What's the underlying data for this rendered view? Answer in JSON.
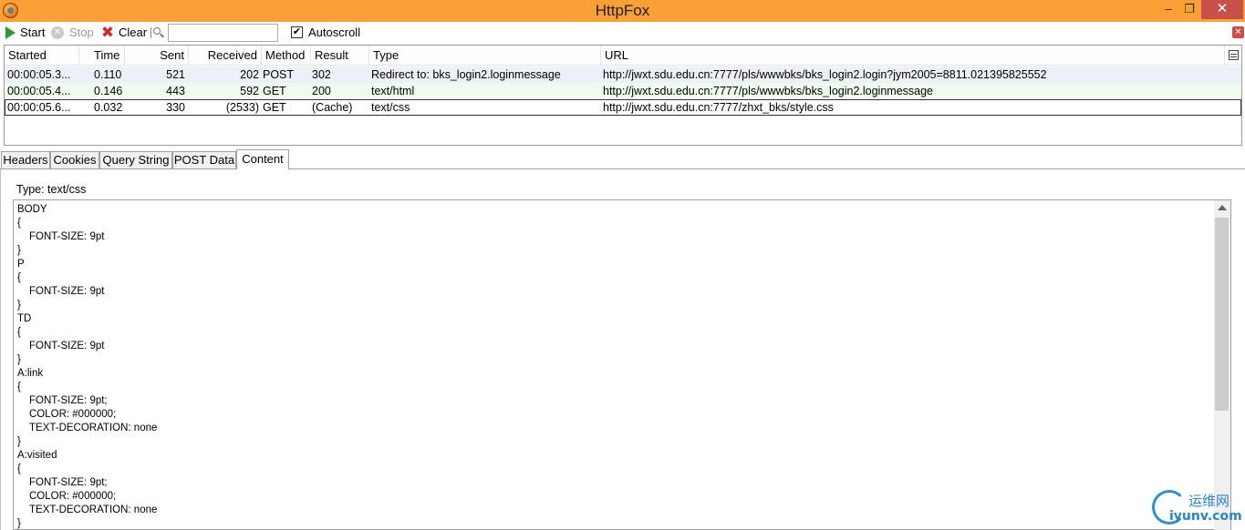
{
  "window": {
    "title": "HttpFox",
    "minimize_glyph": "–",
    "maximize_glyph": "❐",
    "close_glyph": "✕"
  },
  "toolbar": {
    "start_label": "Start",
    "stop_label": "Stop",
    "clear_label": "Clear",
    "search_value": "",
    "autoscroll_label": "Autoscroll",
    "autoscroll_checked": true,
    "icons": [
      "play-icon",
      "stop-icon",
      "clear-x-icon",
      "search-icon",
      "close-panel-icon"
    ]
  },
  "table": {
    "columns": [
      "Started",
      "Time",
      "Sent",
      "Received",
      "Method",
      "Result",
      "Type",
      "URL"
    ],
    "rows": [
      {
        "started": "00:00:05.3...",
        "time": "0.110",
        "sent": "521",
        "received": "202",
        "method": "POST",
        "result": "302",
        "type": "Redirect to: bks_login2.loginmessage",
        "url": "http://jwxt.sdu.edu.cn:7777/pls/wwwbks/bks_login2.login?jym2005=8811.021395825552",
        "bg": "#eef0f9"
      },
      {
        "started": "00:00:05.4...",
        "time": "0.146",
        "sent": "443",
        "received": "592",
        "method": "GET",
        "result": "200",
        "type": "text/html",
        "url": "http://jwxt.sdu.edu.cn:7777/pls/wwwbks/bks_login2.loginmessage",
        "bg": "#eefbee"
      },
      {
        "started": "00:00:05.6...",
        "time": "0.032",
        "sent": "330",
        "received": "(2533)",
        "method": "GET",
        "result": "(Cache)",
        "type": "text/css",
        "url": "http://jwxt.sdu.edu.cn:7777/zhxt_bks/style.css",
        "bg": "#ffffff",
        "selected": true
      }
    ]
  },
  "tabs": [
    {
      "label": "Headers",
      "active": false
    },
    {
      "label": "Cookies",
      "active": false
    },
    {
      "label": "Query String",
      "active": false
    },
    {
      "label": "POST Data",
      "active": false
    },
    {
      "label": "Content",
      "active": true
    }
  ],
  "content": {
    "type_label": "Type: text/css",
    "lines": [
      "BODY",
      "{",
      "FONT-SIZE: 9pt",
      "}",
      "P",
      "{",
      "FONT-SIZE: 9pt",
      "}",
      "TD",
      "{",
      "FONT-SIZE: 9pt",
      "}",
      "A:link",
      "{",
      "FONT-SIZE: 9pt;",
      "COLOR: #000000;",
      "TEXT-DECORATION: none",
      "}",
      "A:visited",
      "{",
      "FONT-SIZE: 9pt;",
      "COLOR: #000000;",
      "TEXT-DECORATION: none",
      "}"
    ],
    "indented": [
      false,
      false,
      true,
      false,
      false,
      false,
      true,
      false,
      false,
      false,
      true,
      false,
      false,
      false,
      true,
      true,
      true,
      false,
      false,
      false,
      true,
      true,
      true,
      false
    ]
  },
  "watermark": {
    "cn": "运维网",
    "en": "iyunv.com"
  },
  "colors": {
    "titlebar": "#fba037",
    "close_button": "#c7504b",
    "start_green": "#2e9b2e",
    "clear_red": "#d22b2b",
    "watermark_blue": "#2a83c4"
  }
}
